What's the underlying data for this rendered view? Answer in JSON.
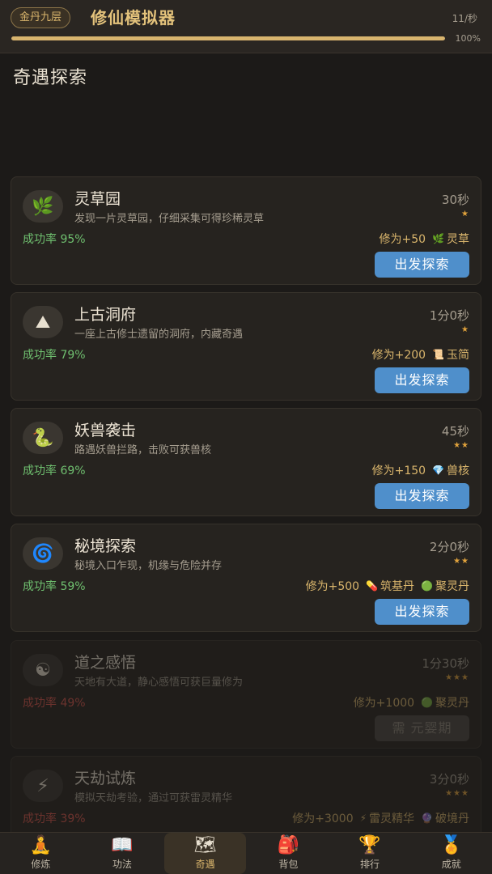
{
  "header": {
    "realm": "金丹九层",
    "title": "修仙模拟器",
    "rate": "11/秒",
    "progress_fraction": 1.0,
    "progress_label": "100%"
  },
  "section_title": "奇遇探索",
  "adventures": [
    {
      "name": "灵草园",
      "desc": "发现一片灵草园，仔细采集可得珍稀灵草",
      "time": "30秒",
      "stars": "★",
      "rate": "成功率 95%",
      "reward_xp": "修为+50",
      "rewards": [
        {
          "icon": "herb-icon",
          "label": "灵草"
        }
      ],
      "button": "出发探索",
      "locked": false,
      "icon": "herb-icon"
    },
    {
      "name": "上古洞府",
      "desc": "一座上古修士遗留的洞府，内藏奇遇",
      "time": "1分0秒",
      "stars": "★",
      "rate": "成功率 79%",
      "reward_xp": "修为+200",
      "rewards": [
        {
          "icon": "scroll-icon",
          "label": "玉简"
        }
      ],
      "button": "出发探索",
      "locked": false,
      "icon": "mountain-icon"
    },
    {
      "name": "妖兽袭击",
      "desc": "路遇妖兽拦路，击败可获兽核",
      "time": "45秒",
      "stars": "★★",
      "rate": "成功率 69%",
      "reward_xp": "修为+150",
      "rewards": [
        {
          "icon": "gem-icon",
          "label": "兽核"
        }
      ],
      "button": "出发探索",
      "locked": false,
      "icon": "serpent-icon"
    },
    {
      "name": "秘境探索",
      "desc": "秘境入口乍现，机缘与危险并存",
      "time": "2分0秒",
      "stars": "★★",
      "rate": "成功率 59%",
      "reward_xp": "修为+500",
      "rewards": [
        {
          "icon": "pill-icon",
          "label": "筑基丹"
        },
        {
          "icon": "green-dot-icon",
          "label": "聚灵丹"
        }
      ],
      "button": "出发探索",
      "locked": false,
      "icon": "vortex-icon"
    },
    {
      "name": "道之感悟",
      "desc": "天地有大道，静心感悟可获巨量修为",
      "time": "1分30秒",
      "stars": "★★★",
      "rate": "成功率 49%",
      "reward_xp": "修为+1000",
      "rewards": [
        {
          "icon": "green-dot-icon",
          "label": "聚灵丹"
        }
      ],
      "button": "需 元婴期",
      "locked": true,
      "icon": "yin-yang-icon"
    },
    {
      "name": "天劫试炼",
      "desc": "模拟天劫考验，通过可获雷灵精华",
      "time": "3分0秒",
      "stars": "★★★",
      "rate": "成功率 39%",
      "reward_xp": "修为+3000",
      "rewards": [
        {
          "icon": "lightning-icon",
          "label": "雷灵精华"
        },
        {
          "icon": "purple-orb-icon",
          "label": "破境丹"
        }
      ],
      "button": "",
      "locked": true,
      "icon": "lightning-icon"
    }
  ],
  "nav": [
    {
      "label": "修炼",
      "icon": "meditation-icon",
      "active": false
    },
    {
      "label": "功法",
      "icon": "book-icon",
      "active": false
    },
    {
      "label": "奇遇",
      "icon": "map-icon",
      "active": true
    },
    {
      "label": "背包",
      "icon": "backpack-icon",
      "active": false
    },
    {
      "label": "排行",
      "icon": "trophy-icon",
      "active": false
    },
    {
      "label": "成就",
      "icon": "medal-icon",
      "active": false
    }
  ],
  "colors": {
    "background": "#1c1a18",
    "card": "#26231f",
    "gold": "#d9b56c",
    "button_blue": "#4f8fcb",
    "success_green": "#6fbf6f",
    "success_red": "#d9544a"
  }
}
